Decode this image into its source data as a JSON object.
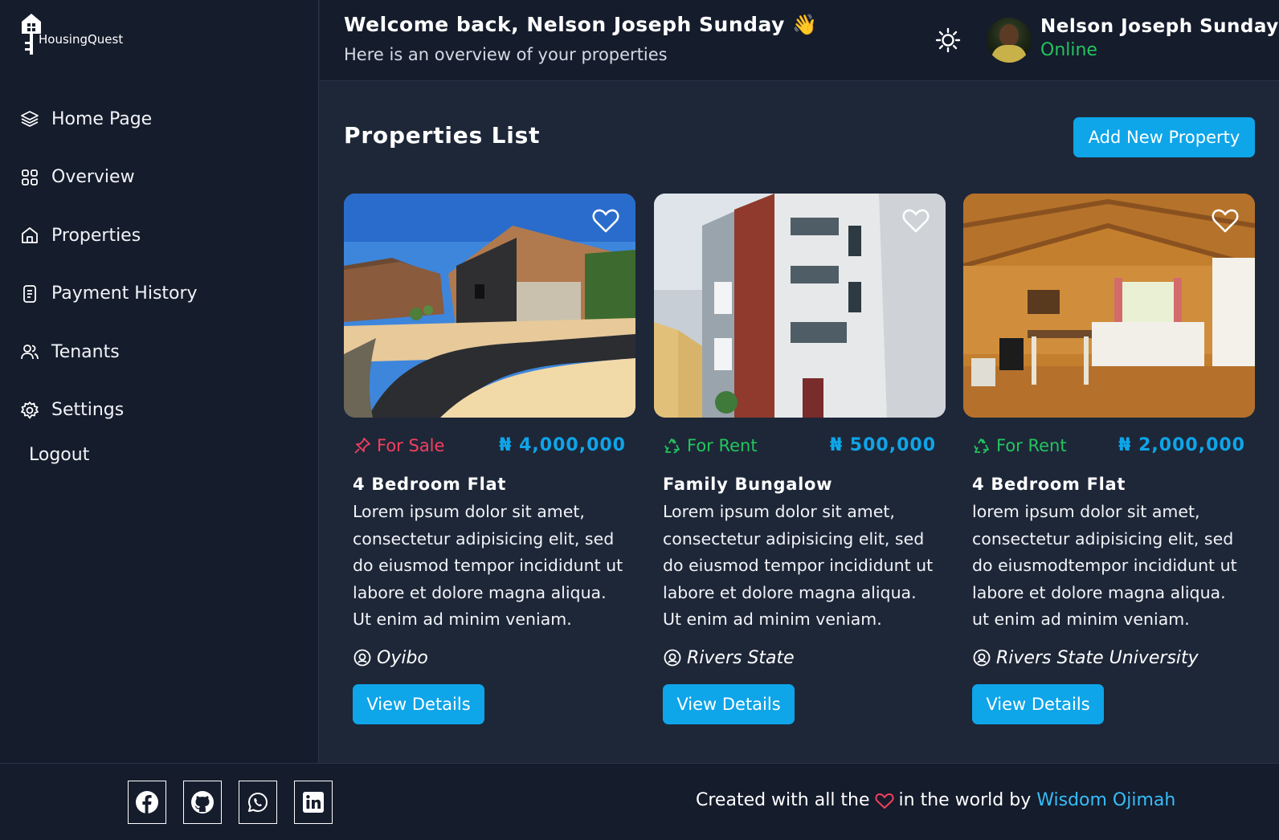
{
  "brand": {
    "name": "HousingQuest"
  },
  "sidebar": {
    "items": [
      {
        "label": "Home Page",
        "icon": "layers-icon"
      },
      {
        "label": "Overview",
        "icon": "grid-icon"
      },
      {
        "label": "Properties",
        "icon": "home-icon"
      },
      {
        "label": "Payment History",
        "icon": "document-icon"
      },
      {
        "label": "Tenants",
        "icon": "users-icon"
      },
      {
        "label": "Settings",
        "icon": "gear-icon"
      }
    ],
    "logout": "Logout"
  },
  "header": {
    "welcome": "Welcome back, Nelson Joseph Sunday 👋",
    "subtitle": "Here is an overview of your properties",
    "user_name": "Nelson Joseph Sunday",
    "user_status": "Online"
  },
  "main": {
    "title": "Properties List",
    "add_button": "Add New Property",
    "properties": [
      {
        "status": "For Sale",
        "status_color": "#f43f5e",
        "price": "₦ 4,000,000",
        "title": "4 Bedroom Flat",
        "description": "Lorem ipsum dolor sit amet, consectetur adipisicing elit, sed do eiusmod tempor incididunt ut labore et dolore magna aliqua. Ut enim ad minim veniam.",
        "location": "Oyibo",
        "button": "View Details"
      },
      {
        "status": "For Rent",
        "status_color": "#22c55e",
        "price": "₦ 500,000",
        "title": "Family Bungalow",
        "description": "Lorem ipsum dolor sit amet, consectetur adipisicing elit, sed do eiusmod tempor incididunt ut labore et dolore magna aliqua. Ut enim ad minim veniam.",
        "location": "Rivers State",
        "button": "View Details"
      },
      {
        "status": "For Rent",
        "status_color": "#22c55e",
        "price": "₦ 2,000,000",
        "title": "4 Bedroom Flat",
        "description": "lorem ipsum dolor sit amet, consectetur adipisicing elit, sed do eiusmodtempor incididunt ut labore et dolore magna aliqua. ut enim ad minim veniam.",
        "location": "Rivers State University",
        "button": "View Details"
      }
    ]
  },
  "footer": {
    "socials": [
      "facebook-icon",
      "github-icon",
      "whatsapp-icon",
      "linkedin-icon"
    ],
    "credit_prefix": "Created with all the",
    "credit_middle": "in the world by",
    "author": "Wisdom Ojimah"
  },
  "colors": {
    "accent": "#0ea5e9",
    "background": "#1e2738",
    "panel": "#151c2c",
    "online": "#22c55e"
  }
}
